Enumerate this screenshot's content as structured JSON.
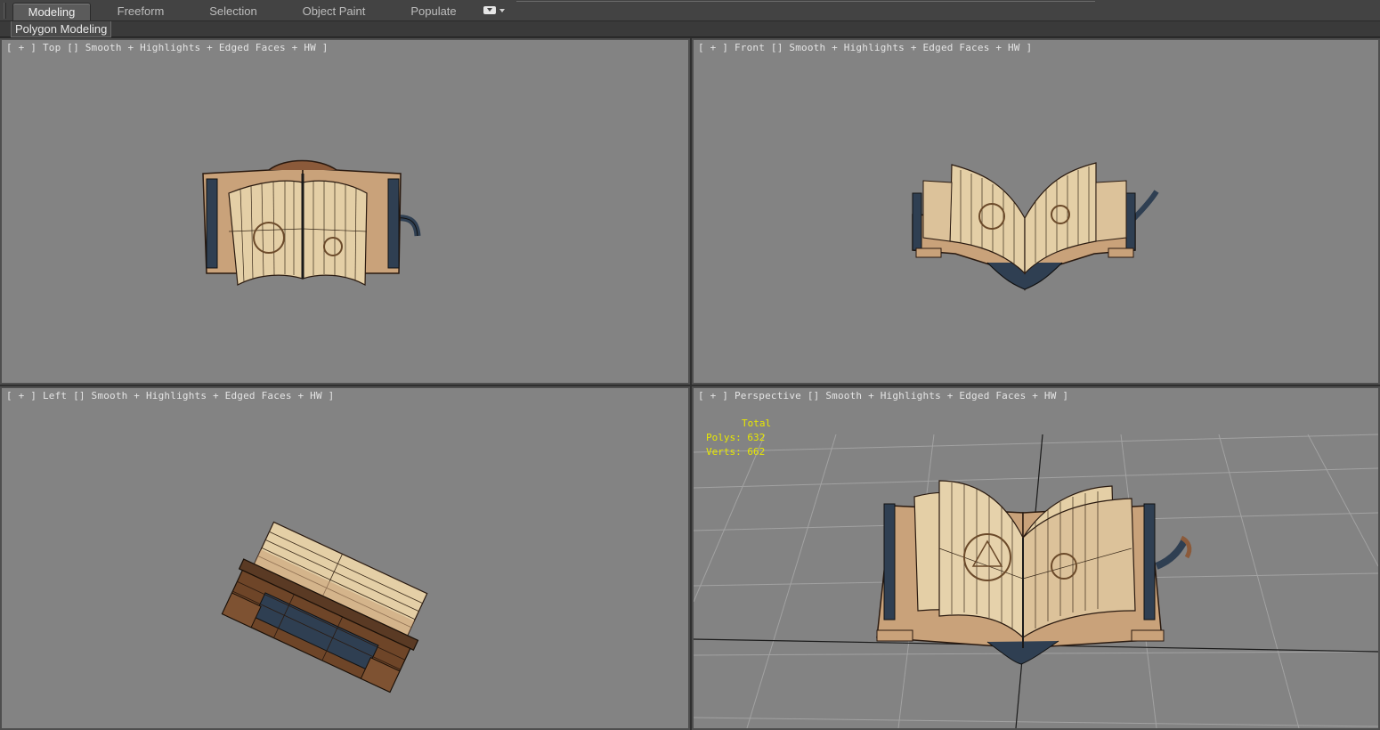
{
  "ribbon": {
    "tabs": [
      {
        "label": "Modeling",
        "active": true
      },
      {
        "label": "Freeform",
        "active": false
      },
      {
        "label": "Selection",
        "active": false
      },
      {
        "label": "Object Paint",
        "active": false
      },
      {
        "label": "Populate",
        "active": false
      }
    ],
    "panel_label": "Polygon Modeling"
  },
  "viewports": {
    "top": {
      "plus": "[ + ]",
      "name": "Top",
      "shading": "Smooth + Highlights + Edged Faces + HW ]"
    },
    "front": {
      "plus": "[ + ]",
      "name": "Front",
      "shading": "Smooth + Highlights + Edged Faces + HW ]"
    },
    "left": {
      "plus": "[ + ]",
      "name": "Left",
      "shading": "Smooth + Highlights + Edged Faces + HW ]"
    },
    "perspective": {
      "plus": "[ + ]",
      "name": "Perspective",
      "shading": "Smooth + Highlights + Edged Faces + HW ]"
    }
  },
  "statistics": {
    "header": "Total",
    "polys_label": "Polys:",
    "polys_value": "632",
    "verts_label": "Verts:",
    "verts_value": "662"
  },
  "colors": {
    "viewport_bg": "#838383",
    "stats_text": "#e8e800",
    "page": "#e4cfa6",
    "leather": "#8b5a3a",
    "strap": "#2f3f52"
  }
}
